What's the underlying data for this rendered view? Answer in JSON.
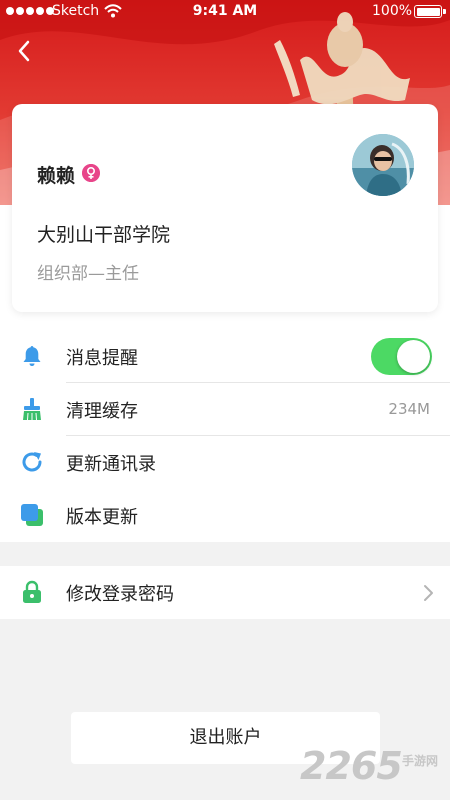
{
  "status_bar": {
    "carrier": "Sketch",
    "time": "9:41 AM",
    "battery": "100%"
  },
  "header": {
    "back_icon": "chevron-left-icon"
  },
  "profile": {
    "name": "赖赖",
    "gender_icon": "female-icon",
    "organization": "大别山干部学院",
    "position": "组织部—主任"
  },
  "settings": {
    "items": [
      {
        "icon": "bell-icon",
        "label": "消息提醒",
        "toggle_on": true
      },
      {
        "icon": "broom-icon",
        "label": "清理缓存",
        "value": "234M"
      },
      {
        "icon": "refresh-icon",
        "label": "更新通讯录"
      },
      {
        "icon": "version-update-icon",
        "label": "版本更新"
      }
    ],
    "security": {
      "icon": "lock-icon",
      "label": "修改登录密码",
      "chevron_icon": "chevron-right-icon"
    }
  },
  "logout": {
    "label": "退出账户"
  },
  "watermark": {
    "number": "2265",
    "text": "手游网"
  },
  "colors": {
    "banner_red": "#d51a1a",
    "toggle_green": "#4cd964",
    "icon_blue": "#3d9be9",
    "icon_green": "#3bbf6b",
    "gender_pink": "#e8458a"
  }
}
